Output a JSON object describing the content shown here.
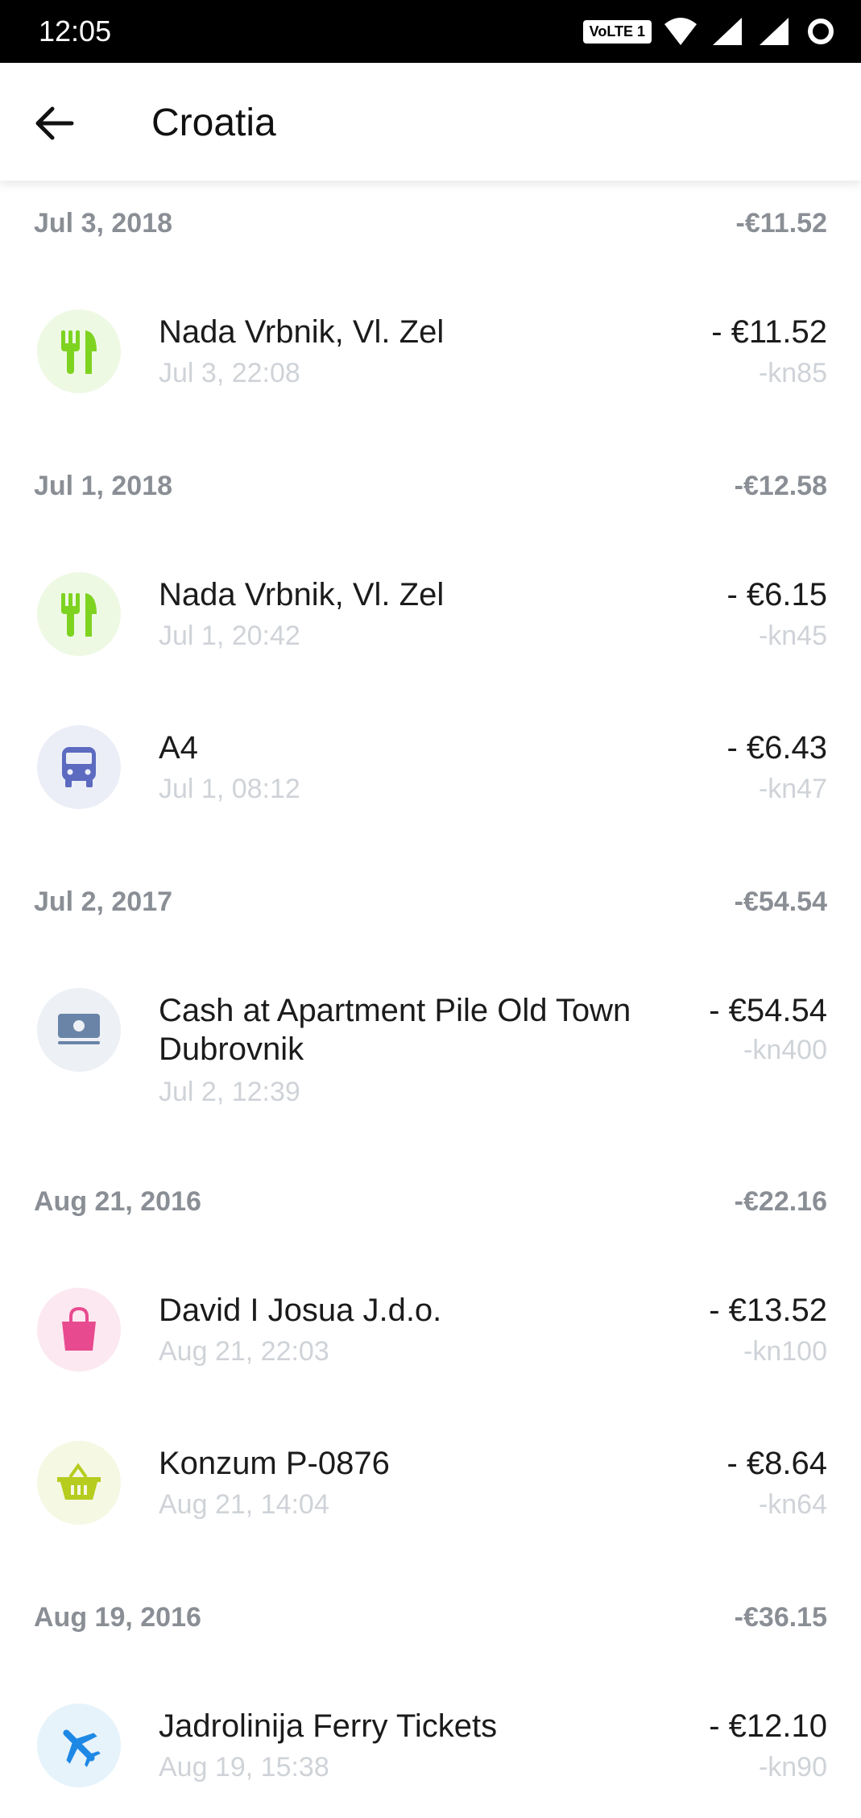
{
  "status_bar": {
    "time": "12:05",
    "network_badge": "VoLTE 1"
  },
  "header": {
    "title": "Croatia",
    "back_icon": "arrow-left-icon"
  },
  "sections": [
    {
      "date": "Jul 3, 2018",
      "total": "-€11.52",
      "transactions": [
        {
          "name": "Nada Vrbnik, Vl. Zel",
          "time": "Jul 3, 22:08",
          "amount": "- €11.52",
          "local_amount": "-kn85",
          "icon": "restaurant-icon",
          "icon_color": "#7ed321",
          "icon_bg": "#eef9e4"
        }
      ]
    },
    {
      "date": "Jul 1, 2018",
      "total": "-€12.58",
      "transactions": [
        {
          "name": "Nada Vrbnik, Vl. Zel",
          "time": "Jul 1, 20:42",
          "amount": "- €6.15",
          "local_amount": "-kn45",
          "icon": "restaurant-icon",
          "icon_color": "#7ed321",
          "icon_bg": "#eef9e4"
        },
        {
          "name": "A4",
          "time": "Jul 1, 08:12",
          "amount": "- €6.43",
          "local_amount": "-kn47",
          "icon": "bus-icon",
          "icon_color": "#5c6bc0",
          "icon_bg": "#eceef7"
        }
      ]
    },
    {
      "date": "Jul 2, 2017",
      "total": "-€54.54",
      "transactions": [
        {
          "name": "Cash at Apartment Pile Old Town Dubrovnik",
          "time": "Jul 2, 12:39",
          "amount": "- €54.54",
          "local_amount": "-kn400",
          "icon": "cash-icon",
          "icon_color": "#6a84a8",
          "icon_bg": "#edf0f4"
        }
      ]
    },
    {
      "date": "Aug 21, 2016",
      "total": "-€22.16",
      "transactions": [
        {
          "name": "David I Josua J.d.o.",
          "time": "Aug 21, 22:03",
          "amount": "- €13.52",
          "local_amount": "-kn100",
          "icon": "shopping-bag-icon",
          "icon_color": "#e84a8f",
          "icon_bg": "#fce8f0"
        },
        {
          "name": "Konzum P-0876",
          "time": "Aug 21, 14:04",
          "amount": "- €8.64",
          "local_amount": "-kn64",
          "icon": "basket-icon",
          "icon_color": "#b6cc1e",
          "icon_bg": "#f5f8e3"
        }
      ]
    },
    {
      "date": "Aug 19, 2016",
      "total": "-€36.15",
      "transactions": [
        {
          "name": "Jadrolinija Ferry Tickets",
          "time": "Aug 19, 15:38",
          "amount": "- €12.10",
          "local_amount": "-kn90",
          "icon": "airplane-icon",
          "icon_color": "#1e88e5",
          "icon_bg": "#e6f3fb"
        }
      ]
    }
  ]
}
